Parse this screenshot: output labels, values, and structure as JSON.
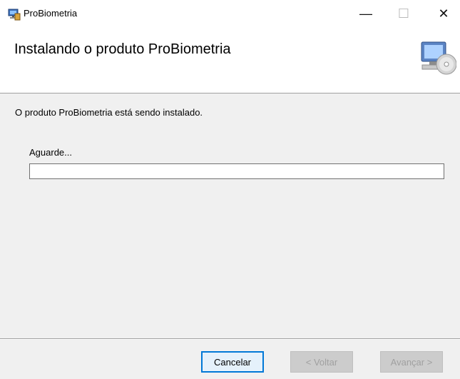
{
  "window": {
    "title": "ProBiometria",
    "minimize_glyph": "—",
    "maximize_glyph": "☐",
    "close_glyph": "✕"
  },
  "header": {
    "title": "Instalando o produto ProBiometria",
    "icon": "installer-computer-disc-icon"
  },
  "main": {
    "status": "O produto ProBiometria está sendo instalado.",
    "wait_label": "Aguarde...",
    "progress": 0
  },
  "footer": {
    "cancel_label": "Cancelar",
    "back_label": "< Voltar",
    "next_label": "Avançar >"
  },
  "colors": {
    "accent": "#0078d7",
    "background": "#f0f0f0",
    "progress_fill": "#06b025"
  }
}
